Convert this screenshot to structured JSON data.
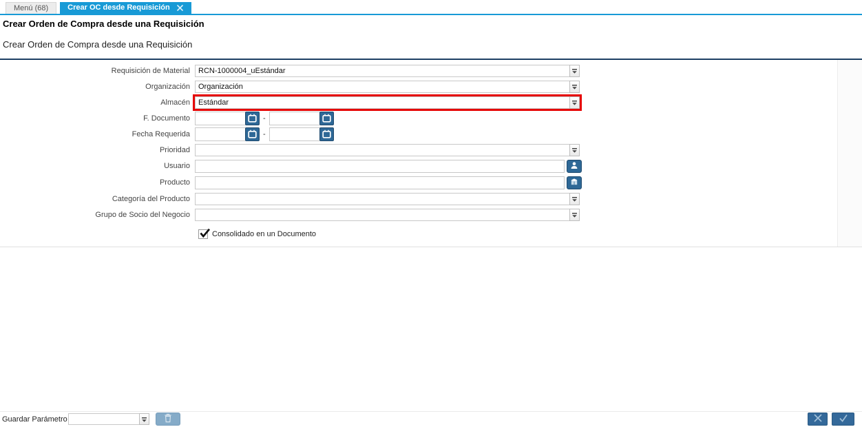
{
  "tabs": [
    {
      "label": "Menú (68)",
      "active": false
    },
    {
      "label": "Crear OC desde Requisición",
      "active": true
    }
  ],
  "page_title": "Crear Orden de Compra desde una Requisición",
  "process_description": "Crear Orden de Compra desde una Requisición",
  "form": {
    "date_separator": "-",
    "fields": [
      {
        "label": "Requisición de Material",
        "type": "combobox",
        "value": "RCN-1000004_uEstándar"
      },
      {
        "label": "Organización",
        "type": "combobox",
        "value": "Organización"
      },
      {
        "label": "Almacén",
        "type": "combobox",
        "value": "Estándar",
        "highlighted": true
      },
      {
        "label": "F. Documento",
        "type": "date-range",
        "value_from": "",
        "value_to": ""
      },
      {
        "label": "Fecha Requerida",
        "type": "date-range",
        "value_from": "",
        "value_to": ""
      },
      {
        "label": "Prioridad",
        "type": "combobox",
        "value": ""
      },
      {
        "label": "Usuario",
        "type": "lookup",
        "value": "",
        "button_icon": "user-icon"
      },
      {
        "label": "Producto",
        "type": "lookup",
        "value": "",
        "button_icon": "product-icon"
      },
      {
        "label": "Categoría del Producto",
        "type": "combobox",
        "value": ""
      },
      {
        "label": "Grupo de Socio del Negocio",
        "type": "combobox",
        "value": ""
      }
    ],
    "checkbox": {
      "label": "Consolidado en un Documento",
      "checked": true
    }
  },
  "footer": {
    "save_parameter_label": "Guardar Parámetro",
    "save_parameter_value": "",
    "delete_button_icon": "trash-icon",
    "cancel_button_icon": "x-icon",
    "confirm_button_icon": "check-icon"
  },
  "colors": {
    "active_tab_blue": "#189ad6",
    "panel_top_border_navy": "#1d3f63",
    "highlight_red": "#e60000",
    "field_button_blue": "#2e6896",
    "footer_button_blue": "#34699a",
    "disabled_button_blue": "#85abc8"
  }
}
